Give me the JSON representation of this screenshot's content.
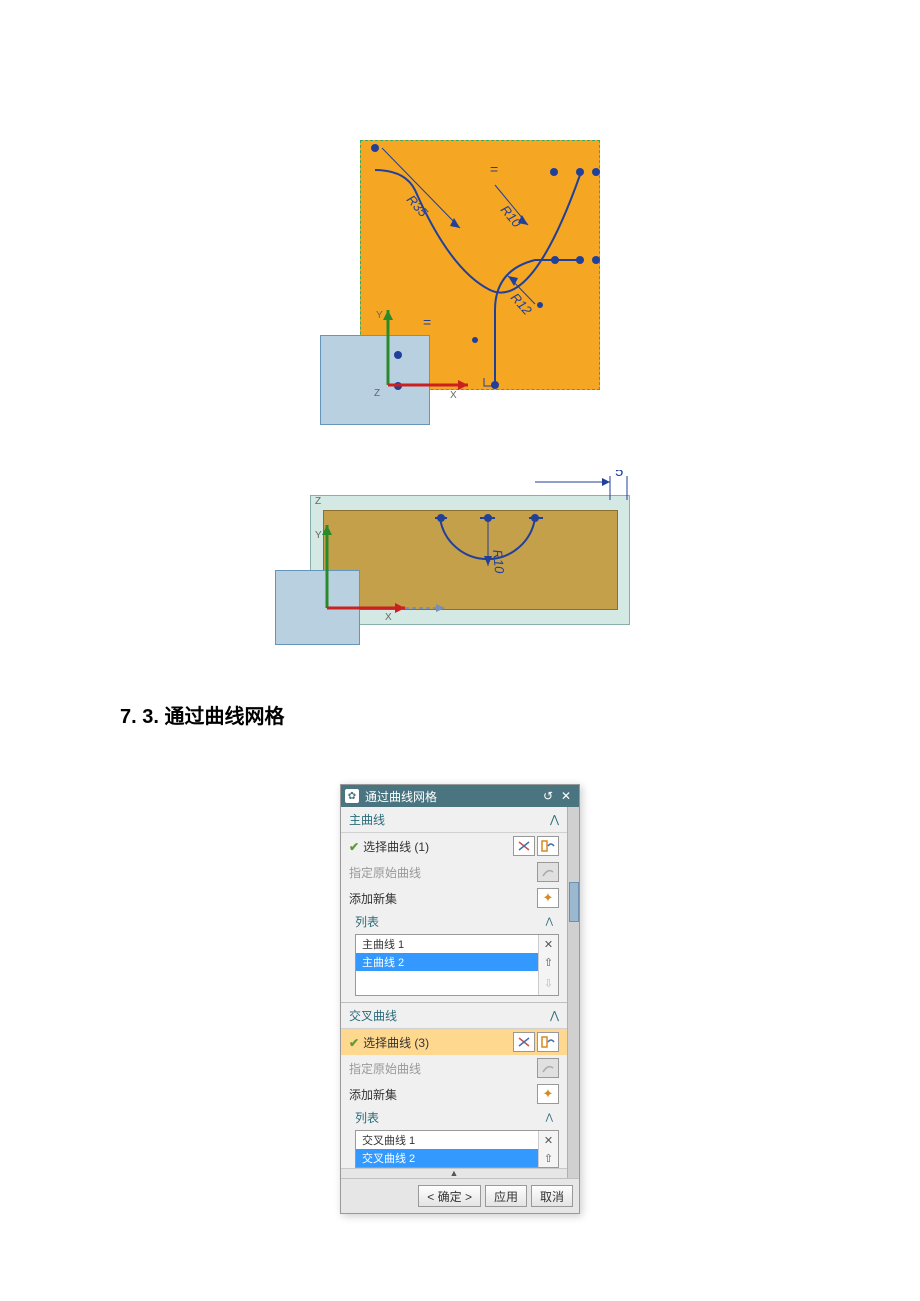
{
  "section_heading": "7. 3. 通过曲线网格",
  "fig1": {
    "dims": {
      "r35": "R35",
      "r10": "R10",
      "r12": "R12"
    },
    "axes": {
      "x": "X",
      "y": "Y",
      "z": "Z"
    },
    "eq_marks": "="
  },
  "fig2": {
    "dim_5": "5",
    "dims": {
      "r10": "R10"
    },
    "axes": {
      "x": "X",
      "y": "Y",
      "z": "Z"
    }
  },
  "dialog": {
    "title": "通过曲线网格",
    "sections": {
      "primary": {
        "header": "主曲线",
        "select_label": "选择曲线 (1)",
        "origin_label": "指定原始曲线",
        "add_new": "添加新集",
        "list_header": "列表",
        "items": [
          "主曲线 1",
          "主曲线 2"
        ]
      },
      "cross": {
        "header": "交叉曲线",
        "select_label": "选择曲线 (3)",
        "origin_label": "指定原始曲线",
        "add_new": "添加新集",
        "list_header": "列表",
        "items": [
          "交叉曲线 1",
          "交叉曲线 2"
        ]
      }
    },
    "buttons": {
      "ok": "< 确定 >",
      "apply": "应用",
      "cancel": "取消"
    }
  }
}
